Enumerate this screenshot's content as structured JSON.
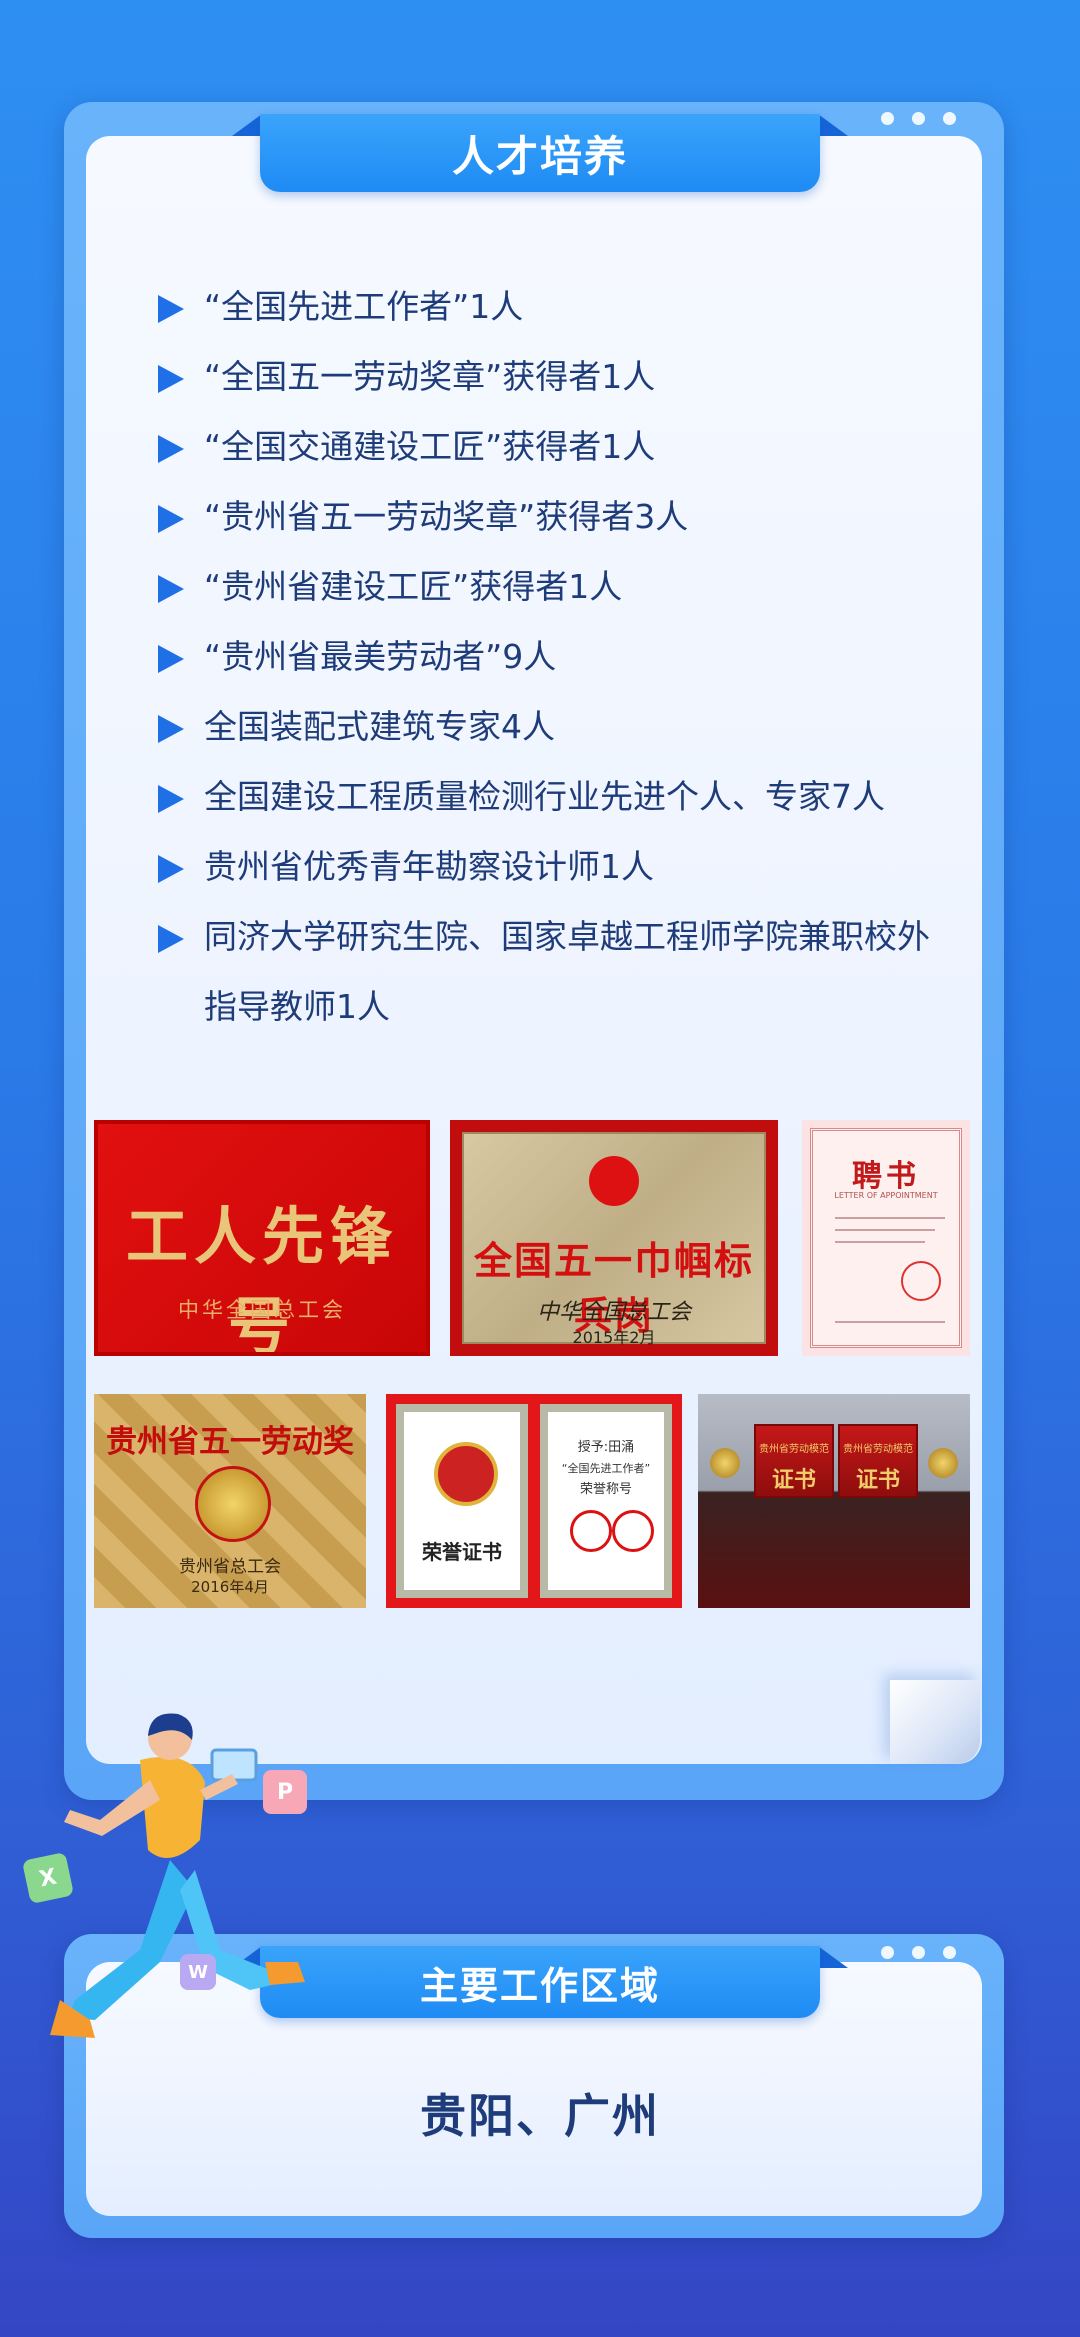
{
  "talent_section": {
    "title": "人才培养",
    "items": [
      "“全国先进工作者”1人",
      "“全国五一劳动奖章”获得者1人",
      "“全国交通建设工匠”获得者1人",
      "“贵州省五一劳动奖章”获得者3人",
      "“贵州省建设工匠”获得者1人",
      "“贵州省最美劳动者”9人",
      "全国装配式建筑专家4人",
      "全国建设工程质量检测行业先进个人、专家7人",
      "贵州省优秀青年勘察设计师1人",
      "同济大学研究生院、国家卓越工程师学院兼职校外指导教师1人"
    ],
    "photos": {
      "worker_pioneer": {
        "title": "工人先锋号",
        "org": "中华全国总工会"
      },
      "may_fourth_post": {
        "title": "全国五一巾帼标兵岗",
        "org": "中华全国总工会",
        "date": "2015年2月"
      },
      "appointment_letter": {
        "title": "聘书",
        "subtitle": "LETTER OF APPOINTMENT"
      },
      "guizhou_labor_award": {
        "title": "贵州省五一劳动奖状",
        "org": "贵州省总工会",
        "date": "2016年4月"
      },
      "honor_certificate": {
        "title": "荣誉证书",
        "recipient": "授予:田涌",
        "award": "“全国先进工作者”",
        "award_sub": "荣誉称号"
      },
      "certificate_boxes": {
        "label": "贵州省劳动模范",
        "title": "证书"
      }
    }
  },
  "region_section": {
    "title": "主要工作区域",
    "value": "贵阳、广州"
  },
  "decor": {
    "chips": [
      "P",
      "X",
      "W"
    ]
  }
}
